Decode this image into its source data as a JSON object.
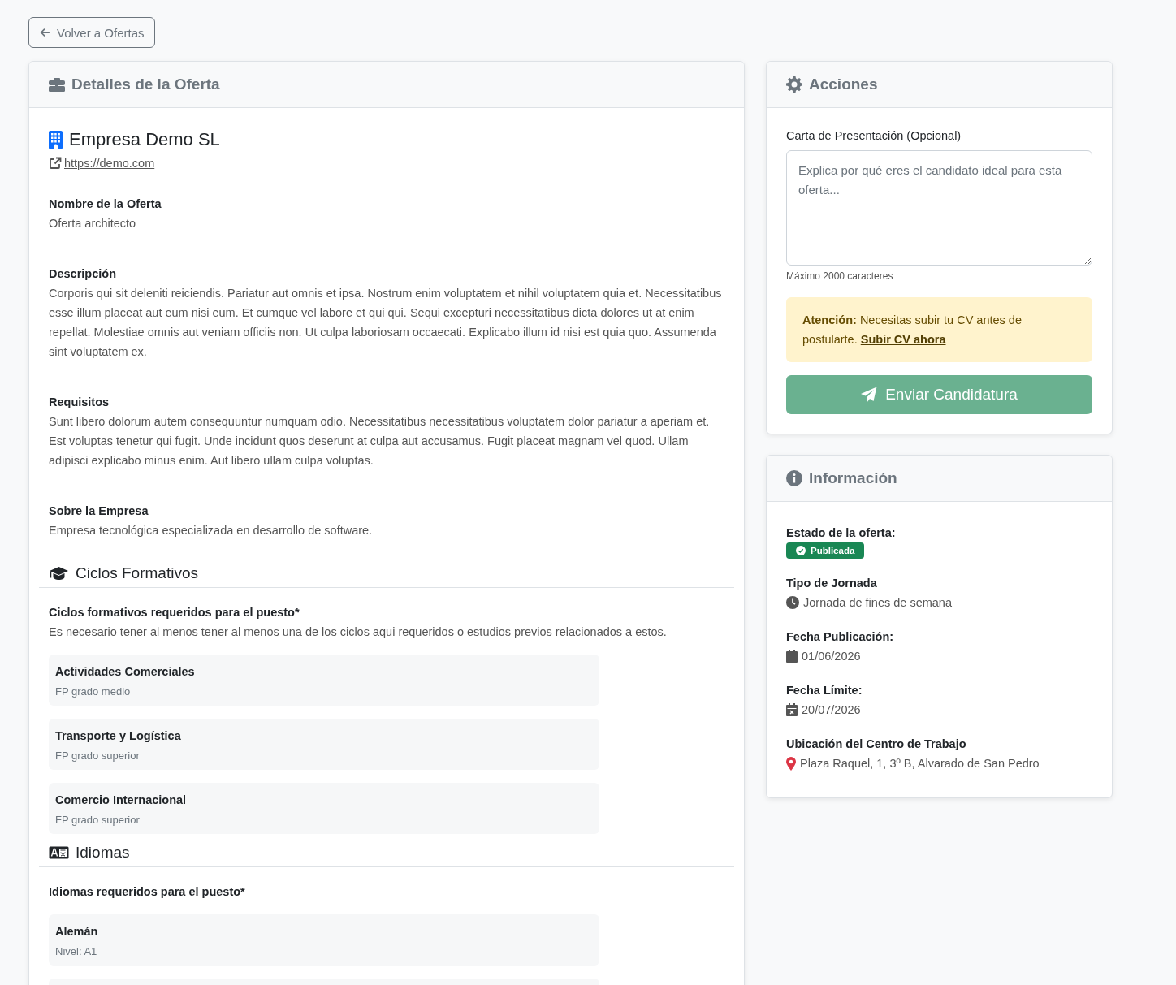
{
  "back_button": {
    "label": "Volver a Ofertas"
  },
  "details": {
    "title": "Detalles de la Oferta",
    "company": "Empresa Demo SL",
    "website": "https://demo.com",
    "sections": [
      {
        "heading": "Nombre de la Oferta",
        "text": "Oferta architecto"
      },
      {
        "heading": "Descripción",
        "text": "Corporis qui sit deleniti reiciendis. Pariatur aut omnis et ipsa. Nostrum enim voluptatem et nihil voluptatem quia et. Necessitatibus esse illum placeat aut eum nisi eum. Et cumque vel labore et qui qui. Sequi excepturi necessitatibus dicta dolores ut at enim repellat. Molestiae omnis aut veniam officiis non. Ut culpa laboriosam occaecati. Explicabo illum id nisi est quia quo. Assumenda sint voluptatem ex."
      },
      {
        "heading": "Requisitos",
        "text": "Sunt libero dolorum autem consequuntur numquam odio. Necessitatibus necessitatibus voluptatem dolor pariatur a aperiam et. Est voluptas tenetur qui fugit. Unde incidunt quos deserunt at culpa aut accusamus. Fugit placeat magnam vel quod. Ullam adipisci explicabo minus enim. Aut libero ullam culpa voluptas."
      },
      {
        "heading": "Sobre la Empresa",
        "text": "Empresa tecnológica especializada en desarrollo de software."
      }
    ],
    "cycles": {
      "title": "Ciclos Formativos",
      "subtitle": "Ciclos formativos requeridos para el puesto*",
      "note": "Es necesario tener al menos tener al menos una de los ciclos aqui requeridos o estudios previos relacionados a estos.",
      "items": [
        {
          "name": "Actividades Comerciales",
          "detail": "FP grado medio"
        },
        {
          "name": "Transporte y Logística",
          "detail": "FP grado superior"
        },
        {
          "name": "Comercio Internacional",
          "detail": "FP grado superior"
        }
      ]
    },
    "languages": {
      "title": "Idiomas",
      "subtitle": "Idiomas requeridos para el puesto*",
      "items": [
        {
          "name": "Alemán",
          "detail": "Nivel: A1"
        }
      ]
    }
  },
  "actions": {
    "title": "Acciones",
    "field_label": "Carta de Presentación (Opcional)",
    "placeholder": "Explica por qué eres el candidato ideal para esta oferta...",
    "hint": "Máximo 2000 caracteres",
    "alert": "**Atención:** Necesitas subir tu CV antes de postularte.",
    "alert_link": "Subir CV ahora",
    "submit": {
      "label": "Enviar Candidatura",
      "disabled": true
    }
  },
  "info": {
    "title": "Información",
    "items": [
      {
        "kind": "status",
        "label": "Estado de la oferta:",
        "value": "Publicada"
      },
      {
        "kind": "schedule",
        "label": "Tipo de Jornada",
        "value": "Jornada de fines de semana"
      },
      {
        "kind": "date",
        "label": "Fecha Publicación:",
        "value": "01/06/2026"
      },
      {
        "kind": "deadline",
        "label": "Fecha Límite:",
        "value": "20/07/2026"
      },
      {
        "kind": "location",
        "label": "Ubicación del Centro de Trabajo",
        "value": "Plaza Raquel, 1, 3º B, Alvarado de San Pedro"
      }
    ]
  }
}
